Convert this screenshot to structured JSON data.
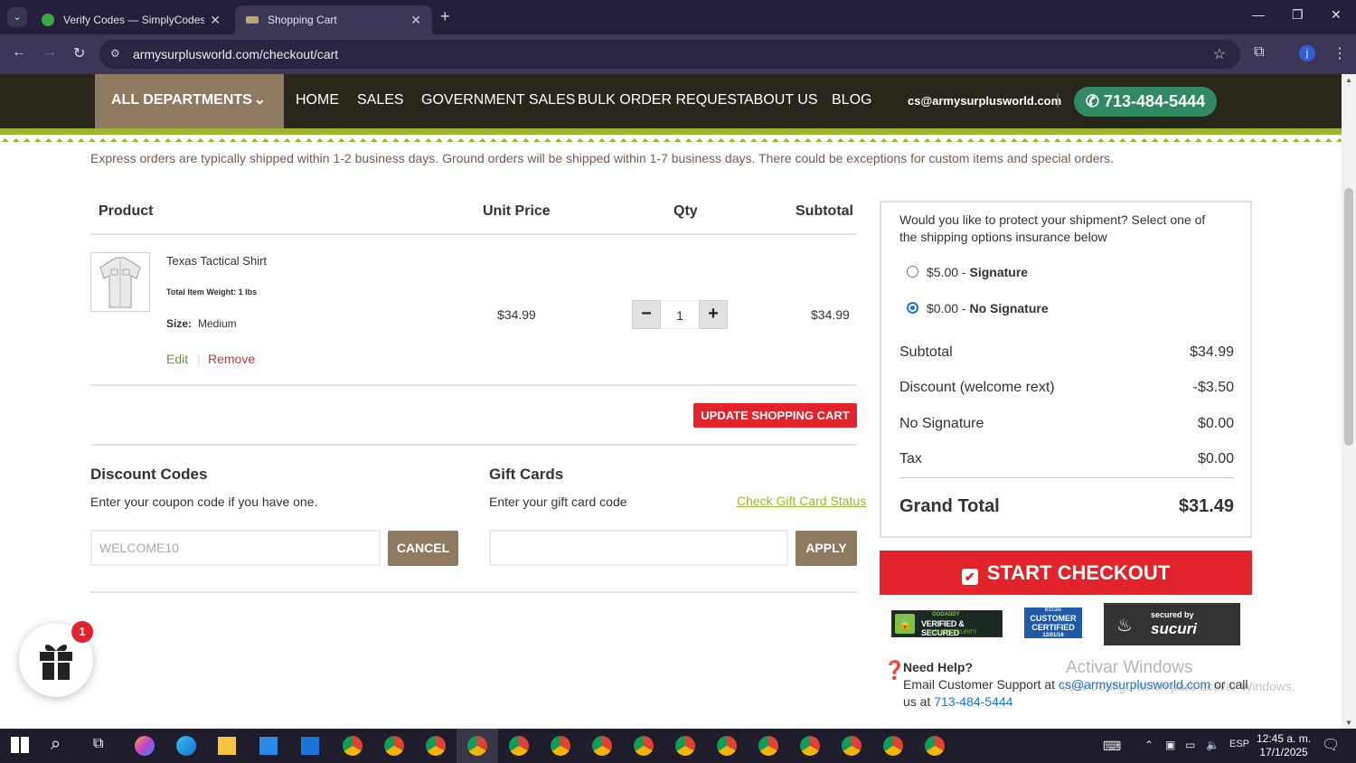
{
  "browser": {
    "tabs": [
      {
        "title": "Verify Codes — SimplyCodes",
        "favicon_color": "#3aa845"
      },
      {
        "title": "Shopping Cart",
        "favicon_color": "#b8a773"
      }
    ],
    "url": "armysurplusworld.com/checkout/cart",
    "profile_initial": "j"
  },
  "header": {
    "all_departments": "ALL DEPARTMENTS",
    "nav": [
      "HOME",
      "SALES",
      "GOVERNMENT SALES",
      "BULK ORDER REQUEST",
      "ABOUT US",
      "BLOG"
    ],
    "email": "cs@armysurplusworld.com",
    "phone": "713-484-5444"
  },
  "shipping_note": "Express orders are typically shipped within 1-2 business days. Ground orders will be shipped within 1-7 business days. There could be exceptions for custom items and special orders.",
  "cart": {
    "columns": {
      "product": "Product",
      "unit_price": "Unit Price",
      "qty": "Qty",
      "subtotal": "Subtotal"
    },
    "item": {
      "name": "Texas Tactical Shirt",
      "weight": "Total Item Weight: 1 lbs",
      "size_label": "Size:",
      "size_value": "Medium",
      "edit": "Edit",
      "remove": "Remove",
      "unit_price": "$34.99",
      "qty": "1",
      "subtotal": "$34.99"
    },
    "update_button": "UPDATE SHOPPING CART"
  },
  "discount": {
    "title": "Discount Codes",
    "subtitle": "Enter your coupon code if you have one.",
    "input_value": "WELCOME10",
    "button": "CANCEL"
  },
  "gift": {
    "title": "Gift Cards",
    "subtitle": "Enter your gift card code",
    "check_link": "Check Gift Card Status",
    "input_value": "",
    "button": "APPLY"
  },
  "summary": {
    "insurance_prompt": "Would you like to protect your shipment? Select one of the shipping options insurance below",
    "options": [
      {
        "price": "$5.00 - ",
        "label": "Signature",
        "selected": false
      },
      {
        "price": "$0.00 - ",
        "label": "No Signature",
        "selected": true
      }
    ],
    "rows": [
      {
        "label": "Subtotal",
        "value": "$34.99"
      },
      {
        "label": "Discount (welcome rext)",
        "value": "-$3.50"
      },
      {
        "label": "No Signature",
        "value": "$0.00"
      },
      {
        "label": "Tax",
        "value": "$0.00"
      }
    ],
    "grand_total_label": "Grand Total",
    "grand_total_value": "$31.49"
  },
  "checkout_button": "START CHECKOUT",
  "badges": {
    "godaddy_top": "GODADDY",
    "godaddy": "VERIFIED & SECURED",
    "godaddy_sub": "VERIFY SECURITY",
    "bizrate_brand": "Bizrate",
    "bizrate_line1": "CUSTOMER",
    "bizrate_line2": "CERTIFIED",
    "bizrate_date": "12/01/16",
    "sucuri_top": "secured by",
    "sucuri_brand": "sucuri"
  },
  "help": {
    "title": "Need Help?",
    "text_prefix": "Email Customer Support at ",
    "email": "cs@armysurplusworld.com",
    "text_mid": " or call us at ",
    "phone": "713-484-5444"
  },
  "gift_badge_count": "1",
  "watermark": {
    "line1": "Activar Windows",
    "line2": "Ve a Configuración para activar Windows."
  },
  "taskbar": {
    "lang": "ESP",
    "time": "12:45 a. m.",
    "date": "17/1/2025"
  }
}
